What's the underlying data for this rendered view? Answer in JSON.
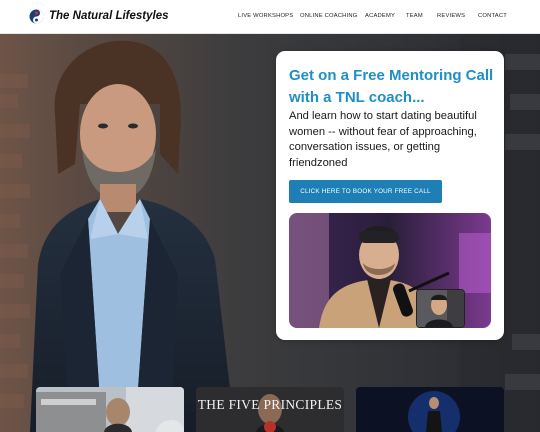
{
  "header": {
    "logo_text": "The Natural Lifestyles",
    "nav": [
      {
        "label": "LIVE WORKSHOPS"
      },
      {
        "label": "ONLINE COACHING"
      },
      {
        "label": "ACADEMY"
      },
      {
        "label": "TEAM"
      },
      {
        "label": "REVIEWS"
      },
      {
        "label": "CONTACT"
      }
    ]
  },
  "hero": {
    "card": {
      "title": "Get on a Free Mentoring Call with a TNL coach...",
      "body": "And learn how to start dating beautiful women -- without fear of approaching, conversation issues, or getting friendzoned",
      "cta_label": "CLICK HERE TO BOOK YOUR FREE CALL"
    }
  },
  "thumbnails": [
    {
      "caption": ""
    },
    {
      "caption": "THE FIVE PRINCIPLES"
    },
    {
      "caption": ""
    }
  ],
  "colors": {
    "accent_blue": "#1f8fc4",
    "button_blue": "#1d7fb6",
    "logo_red": "#d9312b",
    "logo_navy": "#1c3f7a"
  }
}
